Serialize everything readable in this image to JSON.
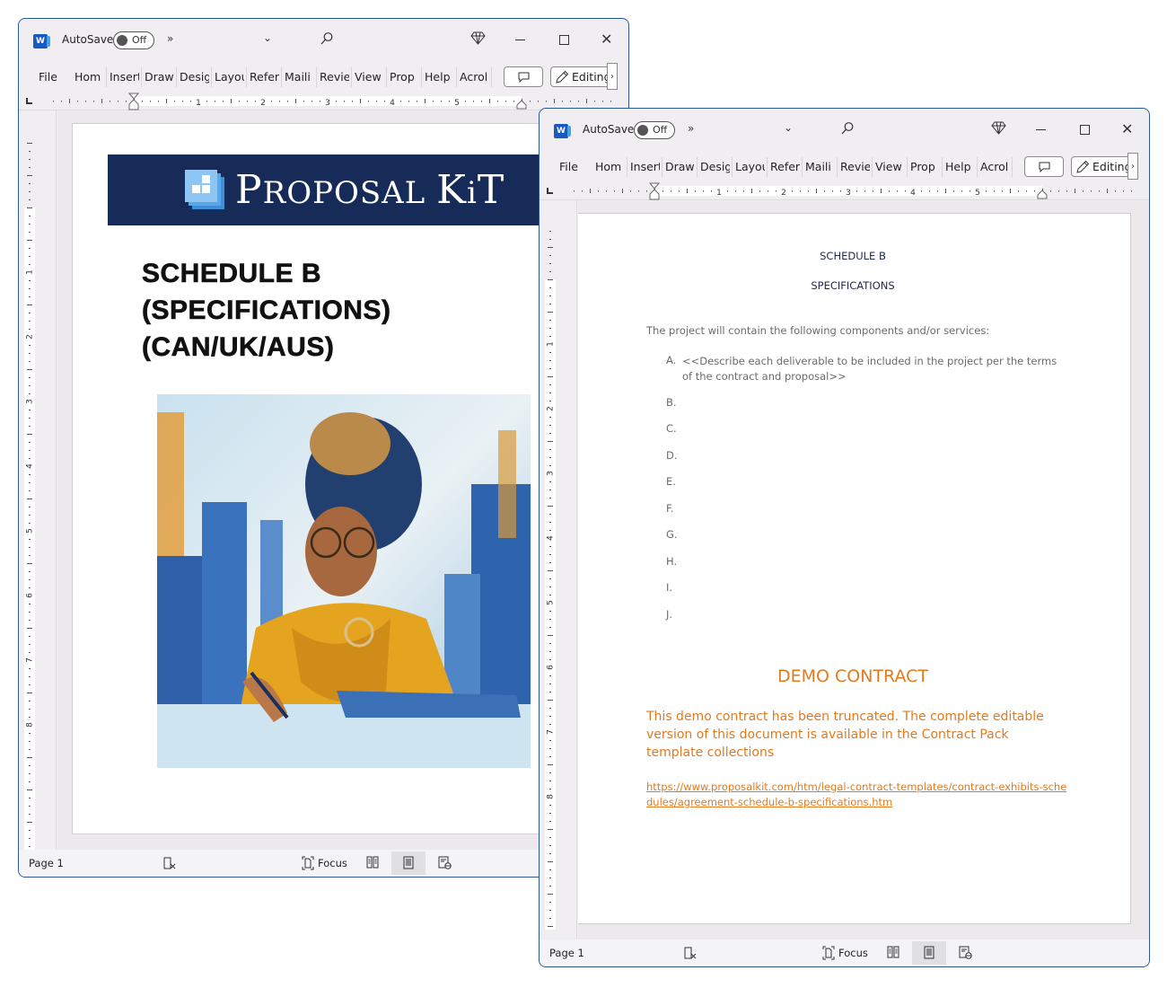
{
  "windows": [
    {
      "app_icon": "word-icon",
      "autosave": {
        "label": "AutoSave",
        "state": "Off"
      },
      "ribbon_tabs": [
        "File",
        "Home",
        "Insert",
        "Draw",
        "Design",
        "Layout",
        "References",
        "Mailings",
        "Review",
        "View",
        "Properties",
        "Help",
        "Acrobat"
      ],
      "ribbon_tabs_visible": [
        "File",
        "Hom",
        "Insert",
        "Draw",
        "Desig",
        "Layou",
        "Refer",
        "Maili",
        "Revie",
        "View",
        "Prop",
        "Help",
        "Acrol"
      ],
      "editing_label": "Editing",
      "ruler_numbers": [
        "1",
        "2",
        "3",
        "4",
        "5"
      ],
      "vruler_numbers": [
        "1",
        "2",
        "3",
        "4",
        "5",
        "6",
        "7",
        "8"
      ],
      "status": {
        "page": "Page 1",
        "focus": "Focus"
      },
      "document": {
        "brand": {
          "first": "P",
          "rest1": "ROPOSAL ",
          "k": "K",
          "i": "i",
          "t": "T"
        },
        "title_lines": [
          "SCHEDULE B",
          "(SPECIFICATIONS)",
          "(CAN/UK/AUS)"
        ],
        "image_alt": "Painted illustration of a woman in a yellow jacket signing documents with a city skyline behind"
      }
    },
    {
      "app_icon": "word-icon",
      "autosave": {
        "label": "AutoSave",
        "state": "Off"
      },
      "ribbon_tabs_visible": [
        "File",
        "Hom",
        "Insert",
        "Draw",
        "Desig",
        "Layou",
        "Refer",
        "Maili",
        "Revie",
        "View",
        "Prop",
        "Help",
        "Acrol"
      ],
      "editing_label": "Editing",
      "ruler_numbers": [
        "1",
        "2",
        "3",
        "4",
        "5"
      ],
      "vruler_numbers": [
        "1",
        "2",
        "3",
        "4",
        "5",
        "6",
        "7",
        "8"
      ],
      "status": {
        "page": "Page 1",
        "focus": "Focus"
      },
      "document": {
        "heading": "SCHEDULE B",
        "subheading": "SPECIFICATIONS",
        "intro": "The project will contain the following components and/or services:",
        "items": [
          {
            "marker": "A.",
            "text": "<<Describe each deliverable to be included in the project per the terms of the contract and proposal>>"
          },
          {
            "marker": "B.",
            "text": ""
          },
          {
            "marker": "C.",
            "text": ""
          },
          {
            "marker": "D.",
            "text": ""
          },
          {
            "marker": "E.",
            "text": ""
          },
          {
            "marker": "F.",
            "text": ""
          },
          {
            "marker": "G.",
            "text": ""
          },
          {
            "marker": "H.",
            "text": ""
          },
          {
            "marker": "I.",
            "text": ""
          },
          {
            "marker": "J.",
            "text": ""
          }
        ],
        "demo_title": "DEMO CONTRACT",
        "demo_body": "This demo contract has been truncated. The complete editable version of this document is available in the Contract Pack template collections",
        "demo_link": "https://www.proposalkit.com/htm/legal-contract-templates/contract-exhibits-schedules/agreement-schedule-b-specifications.htm"
      }
    }
  ],
  "colors": {
    "window_border": "#2b5797",
    "banner_navy": "#162b57",
    "demo_orange": "#e07a1f",
    "word_blue": "#185abd"
  }
}
